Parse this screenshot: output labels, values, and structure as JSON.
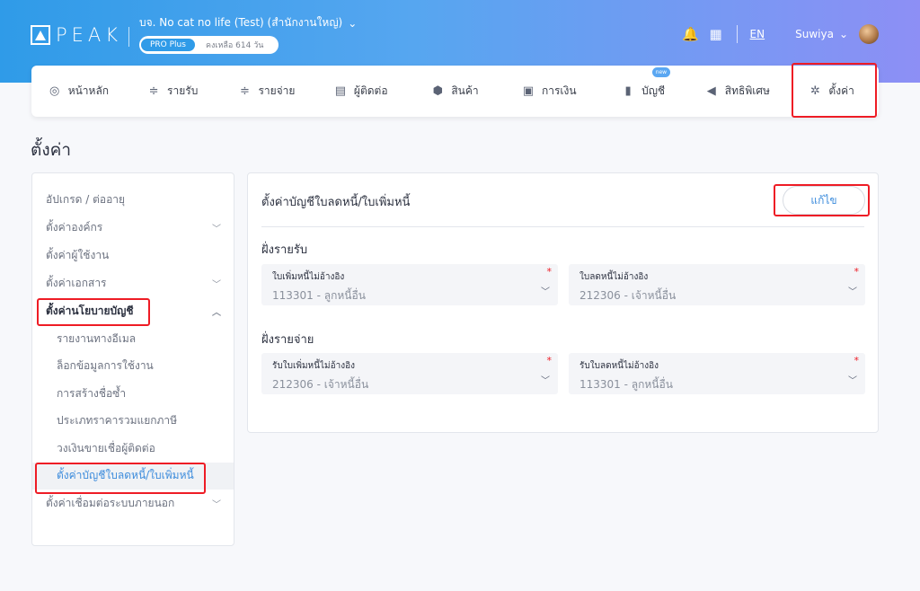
{
  "header": {
    "logo_text": "PEAK",
    "company": "บจ. No cat no life (Test) (สำนักงานใหญ่)",
    "plan": "PRO Plus",
    "remaining": "คงเหลือ 614 วัน",
    "language": "EN",
    "user_name": "Suwiya"
  },
  "nav": {
    "items": [
      {
        "label": "หน้าหลัก",
        "icon": "dashboard-icon"
      },
      {
        "label": "รายรับ",
        "icon": "income-icon"
      },
      {
        "label": "รายจ่าย",
        "icon": "expense-icon"
      },
      {
        "label": "ผู้ติดต่อ",
        "icon": "contacts-icon"
      },
      {
        "label": "สินค้า",
        "icon": "box-icon"
      },
      {
        "label": "การเงิน",
        "icon": "money-icon"
      },
      {
        "label": "บัญชี",
        "icon": "book-icon",
        "badge": "new"
      },
      {
        "label": "สิทธิพิเศษ",
        "icon": "megaphone-icon"
      },
      {
        "label": "ตั้งค่า",
        "icon": "gear-icon"
      }
    ]
  },
  "page": {
    "title": "ตั้งค่า"
  },
  "sidebar": {
    "items": [
      {
        "label": "อัปเกรด / ต่ออายุ"
      },
      {
        "label": "ตั้งค่าองค์กร"
      },
      {
        "label": "ตั้งค่าผู้ใช้งาน"
      },
      {
        "label": "ตั้งค่าเอกสาร"
      },
      {
        "label": "ตั้งค่านโยบายบัญชี"
      },
      {
        "label": "ตั้งค่าเชื่อมต่อระบบภายนอก"
      }
    ],
    "sub_items": [
      {
        "label": "รายงานทางอีเมล"
      },
      {
        "label": "ล็อกข้อมูลการใช้งาน"
      },
      {
        "label": "การสร้างชื่อซ้ำ"
      },
      {
        "label": "ประเภทราคารวมแยกภาษี"
      },
      {
        "label": "วงเงินขายเชื่อผู้ติดต่อ"
      },
      {
        "label": "ตั้งค่าบัญชีใบลดหนี้/ใบเพิ่มหนี้"
      }
    ]
  },
  "panel": {
    "title": "ตั้งค่าบัญชีใบลดหนี้/ใบเพิ่มหนี้",
    "edit_label": "แก้ไข",
    "sections": [
      {
        "title": "ฝั่งรายรับ",
        "fields": [
          {
            "label": "ใบเพิ่มหนี้ไม่อ้างอิง",
            "value": "113301 - ลูกหนี้อื่น"
          },
          {
            "label": "ใบลดหนี้ไม่อ้างอิง",
            "value": "212306 - เจ้าหนี้อื่น"
          }
        ]
      },
      {
        "title": "ฝั่งรายจ่าย",
        "fields": [
          {
            "label": "รับใบเพิ่มหนี้ไม่อ้างอิง",
            "value": "212306 - เจ้าหนี้อื่น"
          },
          {
            "label": "รับใบลดหนี้ไม่อ้างอิง",
            "value": "113301 - ลูกหนี้อื่น"
          }
        ]
      }
    ]
  },
  "colors": {
    "accent": "#3d8cdc",
    "highlight_box": "#ee1c25"
  }
}
